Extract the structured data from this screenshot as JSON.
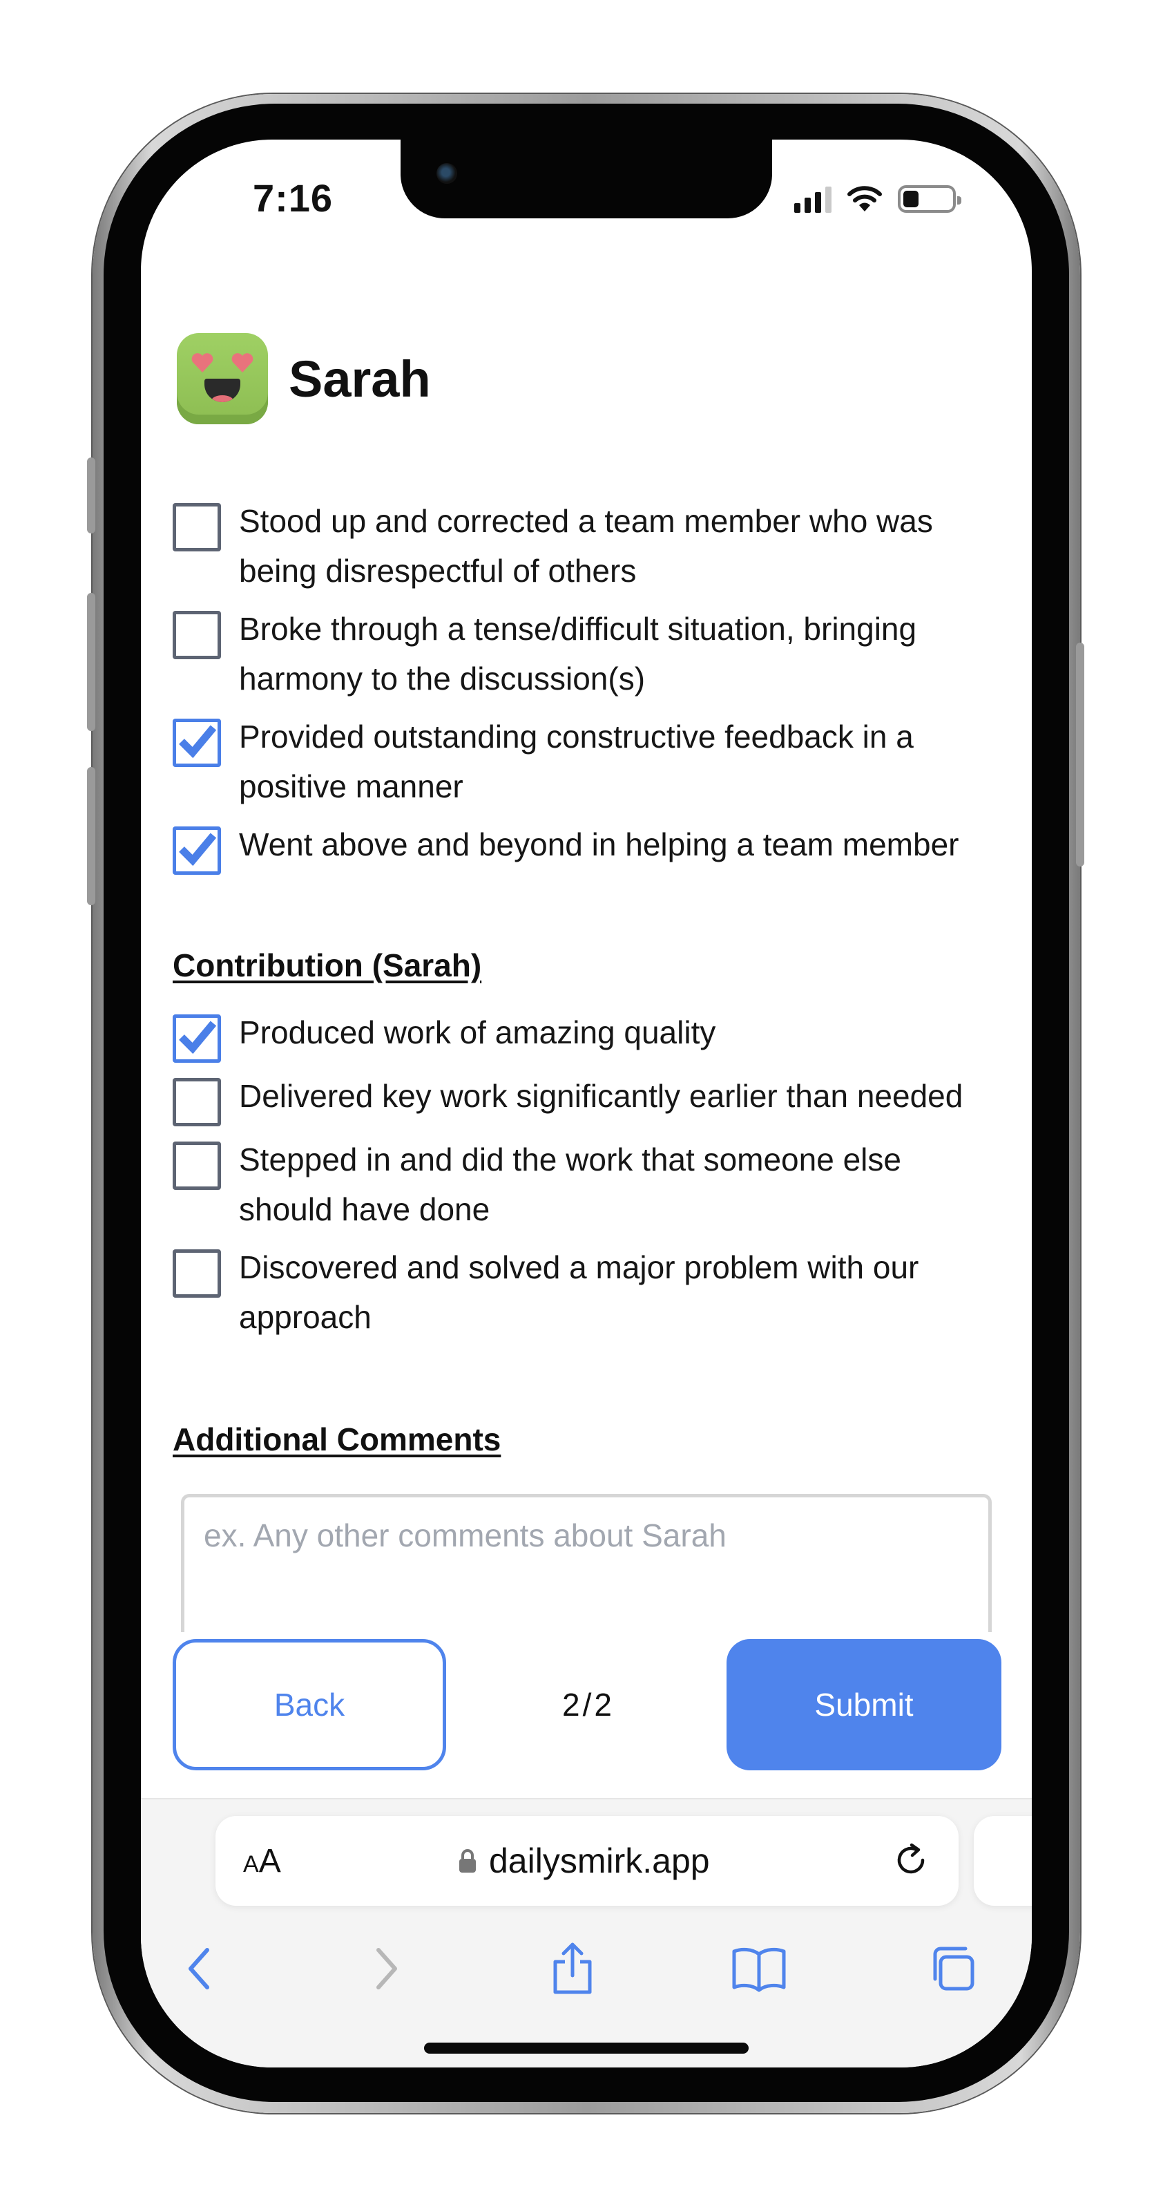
{
  "status_bar": {
    "time": "7:16"
  },
  "profile": {
    "name": "Sarah",
    "avatar_icon": "heart-eyes-face-icon"
  },
  "teamwork_items": [
    {
      "label": "Stood up and corrected a team member who was being disrespectful of others",
      "checked": false
    },
    {
      "label": "Broke through a tense/difficult situation, bringing harmony to the discussion(s)",
      "checked": false
    },
    {
      "label": "Provided outstanding constructive feedback in a positive manner",
      "checked": true
    },
    {
      "label": "Went above and beyond in helping a team member",
      "checked": true
    }
  ],
  "contribution": {
    "title": "Contribution (Sarah)",
    "items": [
      {
        "label": "Produced work of amazing quality",
        "checked": true
      },
      {
        "label": "Delivered key work significantly earlier than needed",
        "checked": false
      },
      {
        "label": "Stepped in and did the work that someone else should have done",
        "checked": false
      },
      {
        "label": "Discovered and solved a major problem with our approach",
        "checked": false
      }
    ]
  },
  "comments": {
    "title": "Additional Comments",
    "placeholder": "ex. Any other comments about Sarah",
    "value": ""
  },
  "footer": {
    "back_label": "Back",
    "page_indicator": "2/2",
    "submit_label": "Submit"
  },
  "browser": {
    "text_size_label_big": "A",
    "text_size_label_small": "A",
    "url": "dailysmirk.app"
  },
  "colors": {
    "accent": "#4f84ec",
    "checkbox_unchecked_border": "#5d6473",
    "avatar_green": "#9fd064"
  }
}
